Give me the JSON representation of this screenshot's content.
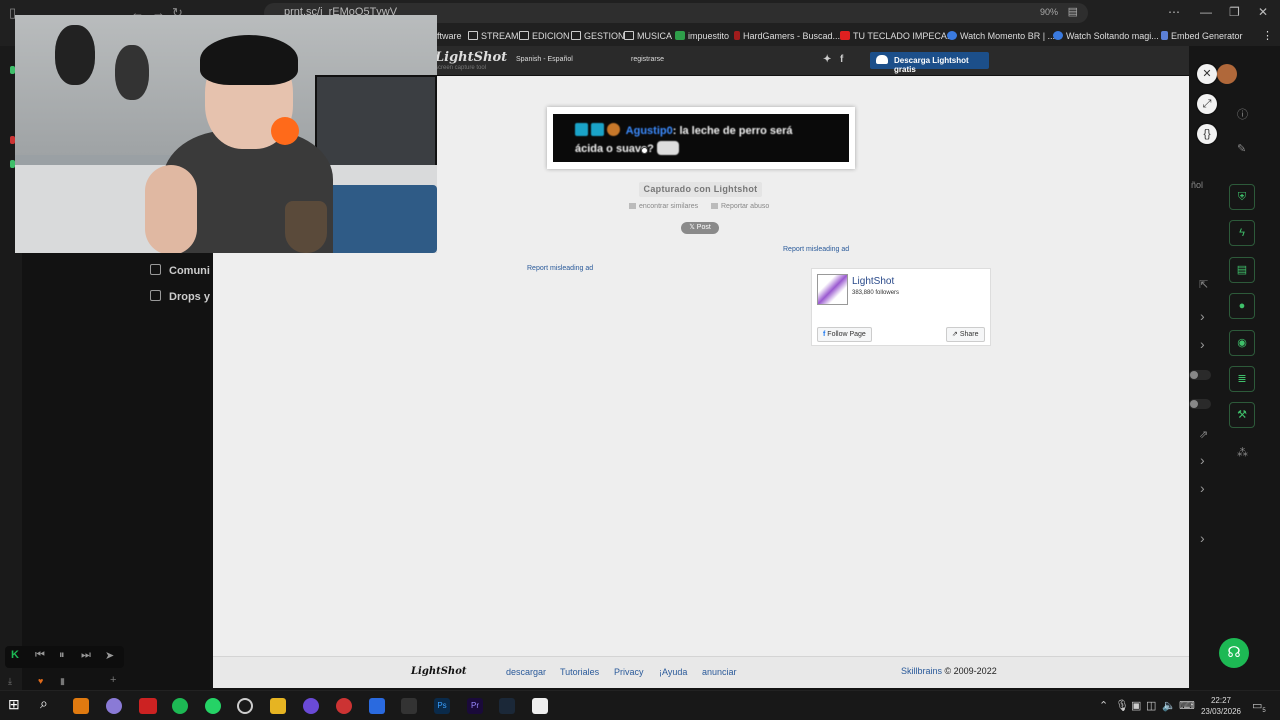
{
  "browser": {
    "url": "prnt.sc/i_rEMoQ5TvwV",
    "zoom": "90%",
    "bookmarks": [
      {
        "label": "ftware"
      },
      {
        "label": "STREAM"
      },
      {
        "label": "EDICION"
      },
      {
        "label": "GESTION"
      },
      {
        "label": "MUSICA"
      },
      {
        "label": "impuestito"
      },
      {
        "label": "HardGamers - Buscad..."
      },
      {
        "label": "TU TECLADO IMPECA..."
      },
      {
        "label": "Watch Momento BR | ..."
      },
      {
        "label": "Watch Soltando magi..."
      },
      {
        "label": "Embed Generator"
      }
    ]
  },
  "background_page": {
    "sidebar": [
      "Comuni",
      "Drops y"
    ],
    "partial_label": "ñol"
  },
  "lightshot": {
    "logo": "LightShot",
    "tagline": "screen capture tool",
    "language": "Spanish - Español",
    "register": "registrarse",
    "download_button": "Descarga Lightshot gratis",
    "screenshot_text": {
      "user": "Agustip0",
      "message_line1": ": la leche de perro será",
      "message_line2": "ácida o suave?"
    },
    "captured_label": "Capturado con Lightshot",
    "find_similar": "encontrar similares",
    "report_abuse": "Reportar abuso",
    "post_button": "Post",
    "report_ad_right": "Report misleading ad",
    "report_ad_left": "Report misleading ad",
    "facebook": {
      "page_name": "LightShot",
      "followers": "383,880 followers",
      "follow_button": "Follow Page",
      "share_button": "Share"
    },
    "footer": {
      "logo": "LightShot",
      "links": [
        "descargar",
        "Tutoriales",
        "Privacy",
        "¡Ayuda",
        "anunciar"
      ],
      "company": "Skillbrains",
      "copyright": "© 2009-2022"
    }
  },
  "taskbar": {
    "time": "22:27",
    "date": "23/03/2026",
    "notification_count": "5"
  }
}
